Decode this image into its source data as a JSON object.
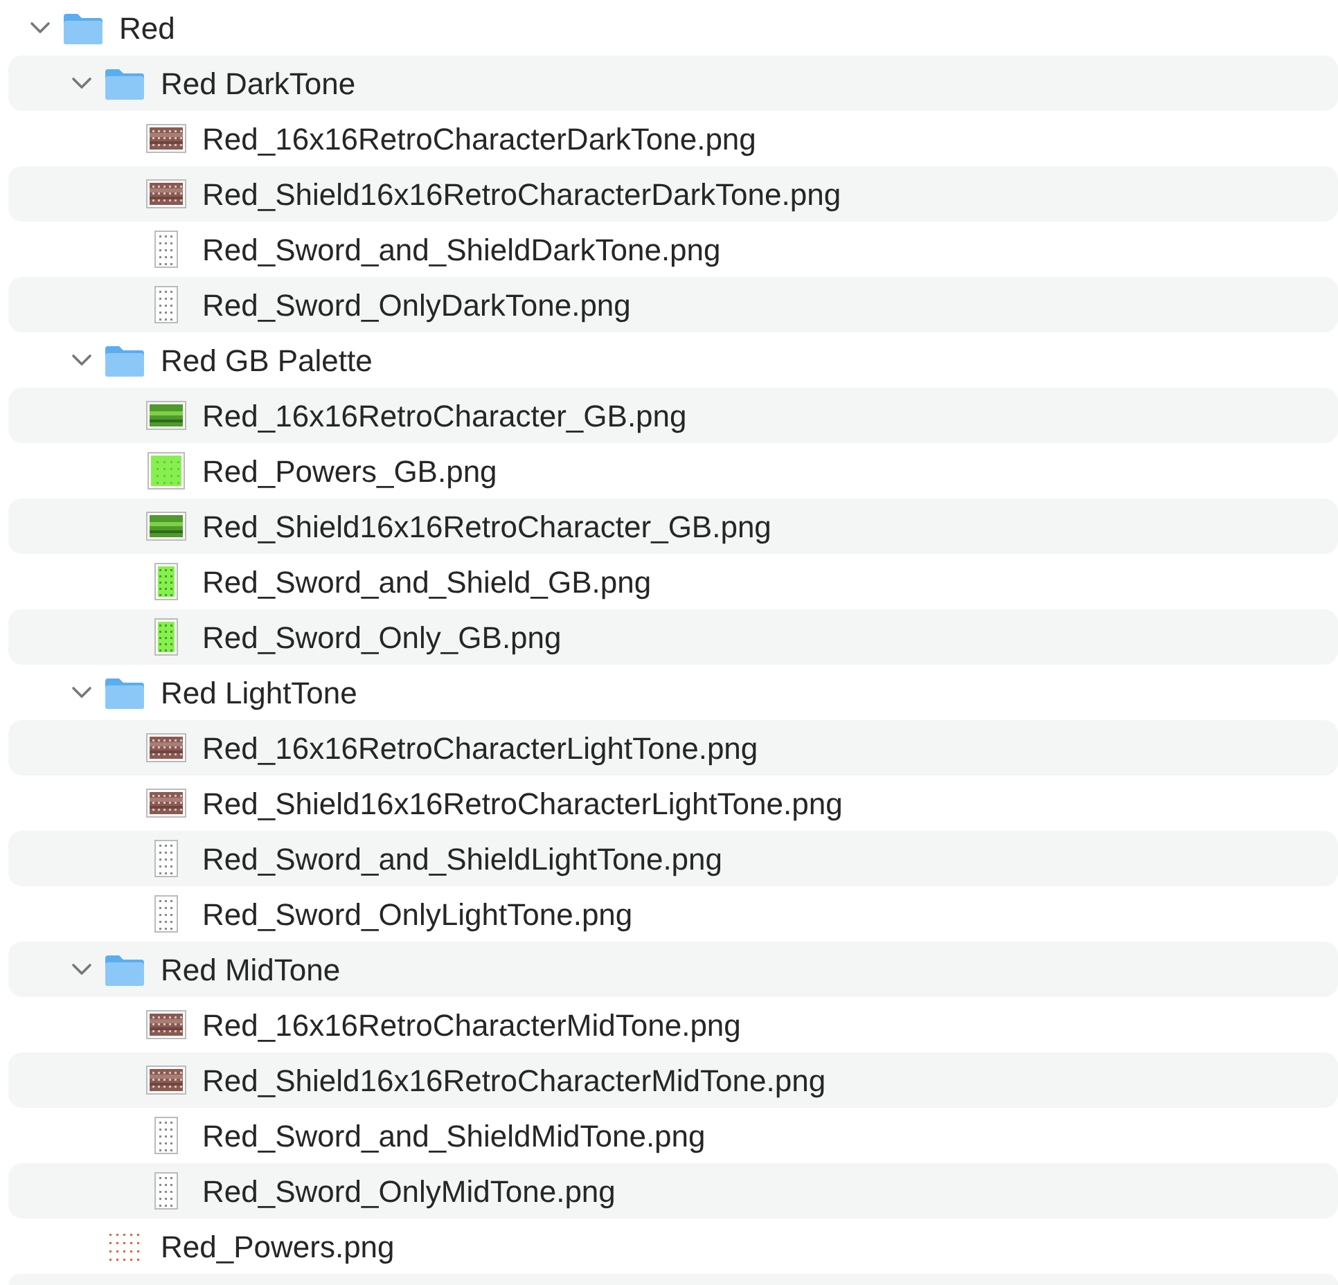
{
  "tree": [
    {
      "kind": "folder",
      "name": "Red",
      "expanded": true,
      "children": [
        {
          "kind": "folder",
          "name": "Red DarkTone",
          "expanded": true,
          "children": [
            {
              "kind": "brown-sheet",
              "name": "Red_16x16RetroCharacterDarkTone.png"
            },
            {
              "kind": "brown-sheet",
              "name": "Red_Shield16x16RetroCharacterDarkTone.png"
            },
            {
              "kind": "white-tall",
              "name": "Red_Sword_and_ShieldDarkTone.png"
            },
            {
              "kind": "white-tall",
              "name": "Red_Sword_OnlyDarkTone.png"
            }
          ]
        },
        {
          "kind": "folder",
          "name": "Red GB Palette",
          "expanded": true,
          "children": [
            {
              "kind": "green-sheet",
              "name": "Red_16x16RetroCharacter_GB.png"
            },
            {
              "kind": "green-square",
              "name": "Red_Powers_GB.png"
            },
            {
              "kind": "green-sheet",
              "name": "Red_Shield16x16RetroCharacter_GB.png"
            },
            {
              "kind": "green-tall",
              "name": "Red_Sword_and_Shield_GB.png"
            },
            {
              "kind": "green-tall",
              "name": "Red_Sword_Only_GB.png"
            }
          ]
        },
        {
          "kind": "folder",
          "name": "Red LightTone",
          "expanded": true,
          "children": [
            {
              "kind": "brown-sheet",
              "name": "Red_16x16RetroCharacterLightTone.png"
            },
            {
              "kind": "brown-sheet",
              "name": "Red_Shield16x16RetroCharacterLightTone.png"
            },
            {
              "kind": "white-tall",
              "name": "Red_Sword_and_ShieldLightTone.png"
            },
            {
              "kind": "white-tall",
              "name": "Red_Sword_OnlyLightTone.png"
            }
          ]
        },
        {
          "kind": "folder",
          "name": "Red MidTone",
          "expanded": true,
          "children": [
            {
              "kind": "brown-sheet",
              "name": "Red_16x16RetroCharacterMidTone.png"
            },
            {
              "kind": "brown-sheet",
              "name": "Red_Shield16x16RetroCharacterMidTone.png"
            },
            {
              "kind": "white-tall",
              "name": "Red_Sword_and_ShieldMidTone.png"
            },
            {
              "kind": "white-tall",
              "name": "Red_Sword_OnlyMidTone.png"
            }
          ]
        },
        {
          "kind": "red-dots",
          "name": "Red_Powers.png"
        }
      ]
    }
  ]
}
